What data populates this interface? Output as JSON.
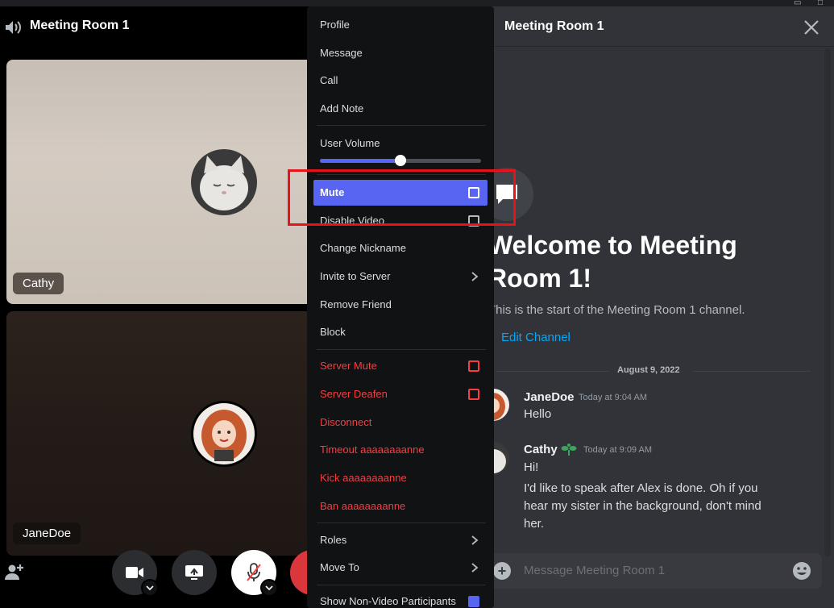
{
  "window": {
    "minimize_glyph": "▭",
    "maximize_glyph": "□"
  },
  "voice": {
    "channel_title": "Meeting Room 1",
    "participants": [
      {
        "name": "Cathy"
      },
      {
        "name": "JaneDoe"
      }
    ]
  },
  "chat": {
    "title": "Meeting Room 1",
    "welcome_title": "Welcome to Meeting\nRoom 1!",
    "welcome_sub": "This is the start of the Meeting Room 1 channel.",
    "edit_channel": "Edit Channel",
    "date_divider": "August 9, 2022",
    "messages": [
      {
        "author": "JaneDoe",
        "timestamp": "Today at 9:04 AM",
        "lines": [
          "Hello"
        ]
      },
      {
        "author": "Cathy",
        "timestamp": "Today at 9:09 AM",
        "lines": [
          "Hi!",
          "I'd like to speak after Alex is done. Oh if you",
          "hear my sister in the background, don't mind",
          "her."
        ]
      }
    ],
    "composer_placeholder": "Message Meeting Room 1"
  },
  "menu": {
    "profile": "Profile",
    "message": "Message",
    "call": "Call",
    "add_note": "Add Note",
    "user_volume": "User Volume",
    "user_volume_level": 0.5,
    "mute": "Mute",
    "disable_video": "Disable Video",
    "change_nickname": "Change Nickname",
    "invite_to_server": "Invite to Server",
    "remove_friend": "Remove Friend",
    "block": "Block",
    "server_mute": "Server Mute",
    "server_deafen": "Server Deafen",
    "disconnect": "Disconnect",
    "timeout": "Timeout aaaaaaaanne",
    "kick": "Kick aaaaaaaanne",
    "ban": "Ban aaaaaaaanne",
    "roles": "Roles",
    "move_to": "Move To",
    "show_non_video": "Show Non-Video Participants"
  },
  "colors": {
    "accent": "#5865f2",
    "danger": "#f23f43",
    "link": "#00a8fc",
    "annotation": "#e8121b"
  }
}
